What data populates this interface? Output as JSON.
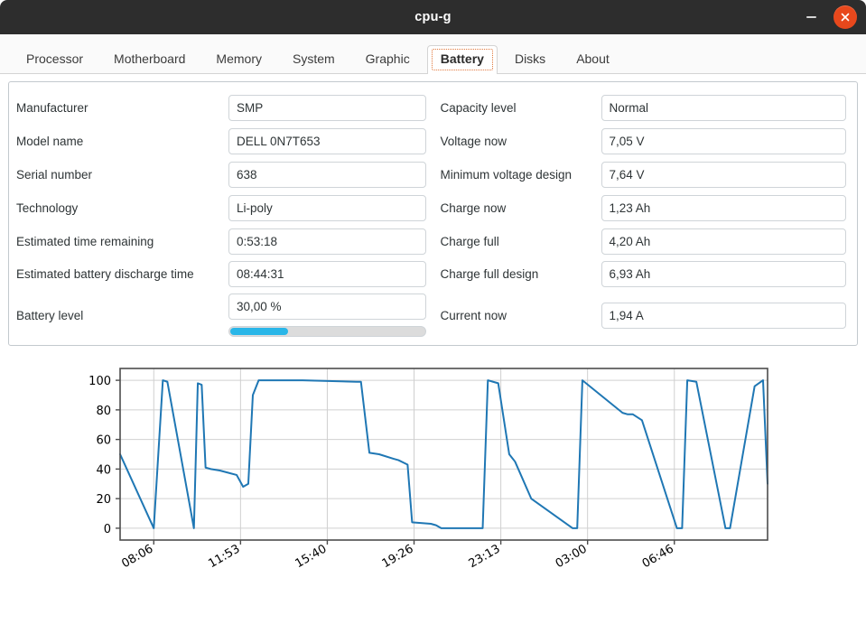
{
  "window": {
    "title": "cpu-g",
    "minimize_label": "–",
    "close_label": "×",
    "close_color": "#e8481c",
    "titlebar_color": "#2d2d2d"
  },
  "tabs": [
    {
      "label": "Processor",
      "active": false
    },
    {
      "label": "Motherboard",
      "active": false
    },
    {
      "label": "Memory",
      "active": false
    },
    {
      "label": "System",
      "active": false
    },
    {
      "label": "Graphic",
      "active": false
    },
    {
      "label": "Battery",
      "active": true
    },
    {
      "label": "Disks",
      "active": false
    },
    {
      "label": "About",
      "active": false
    }
  ],
  "battery": {
    "left_fields": [
      {
        "label": "Manufacturer",
        "value": "SMP"
      },
      {
        "label": "Model name",
        "value": "DELL 0N7T653"
      },
      {
        "label": "Serial number",
        "value": "638"
      },
      {
        "label": "Technology",
        "value": "Li-poly"
      },
      {
        "label": "Estimated time remaining",
        "value": "0:53:18"
      },
      {
        "label": "Estimated battery discharge time",
        "value": "08:44:31"
      }
    ],
    "battery_level": {
      "label": "Battery level",
      "value": "30,00 %",
      "percent": 30,
      "fill_color": "#29b6e8"
    },
    "right_fields": [
      {
        "label": "Capacity level",
        "value": "Normal"
      },
      {
        "label": "Voltage now",
        "value": "7,05 V"
      },
      {
        "label": "Minimum voltage design",
        "value": "7,64 V"
      },
      {
        "label": "Charge now",
        "value": "1,23 Ah"
      },
      {
        "label": "Charge full",
        "value": "4,20 Ah"
      },
      {
        "label": "Charge full design",
        "value": "6,93 Ah"
      },
      {
        "label": "Current now",
        "value": "1,94 A"
      }
    ]
  },
  "chart_data": {
    "type": "line",
    "title": "",
    "xlabel": "",
    "ylabel": "",
    "line_color": "#1f77b4",
    "grid": true,
    "legend": "none",
    "ylim": [
      -8,
      108
    ],
    "yticks": [
      0,
      20,
      40,
      60,
      80,
      100
    ],
    "ytick_labels": [
      "0",
      "20",
      "40",
      "60",
      "80",
      "100"
    ],
    "xlim": [
      0,
      100
    ],
    "xticks": [
      5.2,
      18.6,
      32.0,
      45.4,
      58.8,
      72.2,
      85.6
    ],
    "xtick_labels": [
      "08:06",
      "11:53",
      "15:40",
      "19:26",
      "23:13",
      "03:00",
      "06:46"
    ],
    "xtick_rotation": 30,
    "x": [
      0.0,
      5.2,
      6.6,
      7.3,
      11.4,
      12.0,
      12.6,
      13.2,
      14.0,
      15.4,
      18.0,
      19.0,
      19.8,
      20.5,
      21.4,
      28.2,
      36.5,
      37.2,
      38.5,
      40.0,
      42.2,
      43.0,
      44.4,
      45.1,
      48.0,
      48.8,
      49.6,
      56.0,
      56.8,
      57.6,
      58.4,
      60.1,
      61.0,
      63.5,
      69.9,
      70.6,
      71.4,
      77.6,
      78.4,
      79.2,
      80.6,
      86.0,
      86.8,
      87.6,
      89.0,
      93.5,
      94.2,
      98.0,
      99.3,
      100.0
    ],
    "y": [
      50,
      0,
      100,
      99,
      0,
      98,
      97,
      41,
      40,
      39,
      36,
      28,
      30,
      90,
      100,
      100,
      99,
      99,
      51,
      50,
      47,
      46,
      43,
      4,
      3,
      2,
      0,
      0,
      100,
      99,
      98,
      50,
      45,
      20,
      0,
      0,
      100,
      78,
      77,
      77,
      73,
      0,
      0,
      100,
      99,
      0,
      0,
      96,
      100,
      30
    ],
    "description": "Battery level history over ~24h with repeated charge/discharge cycles, y in percent"
  }
}
